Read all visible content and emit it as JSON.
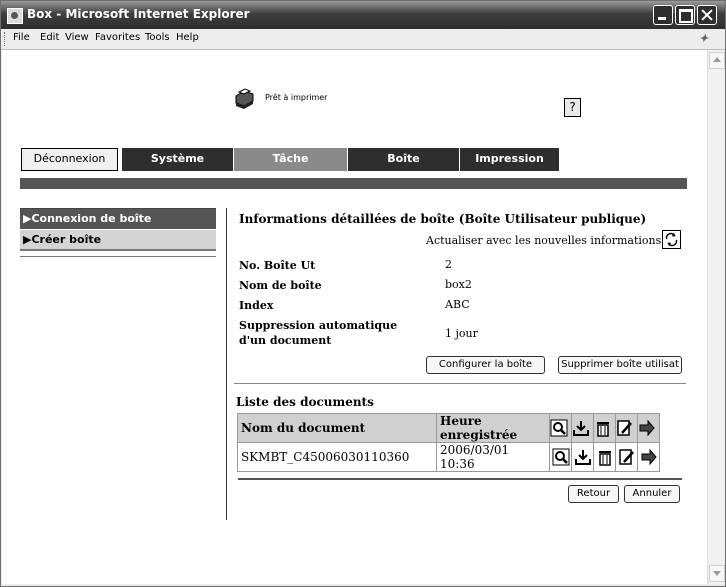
{
  "window": {
    "title": "Box - Microsoft Internet Explorer"
  },
  "menu": [
    "File",
    "Edit",
    "View",
    "Favorites",
    "Tools",
    "Help"
  ],
  "header": {
    "status": "Prêt à imprimer",
    "help": "?"
  },
  "tabs": {
    "logout": "Déconnexion",
    "system": "Système",
    "task": "Tâche",
    "box": "Boîte",
    "print": "Impression"
  },
  "sidebar": {
    "items": [
      {
        "label": "▶Connexion de boîte"
      },
      {
        "label": "▶Créer boîte"
      }
    ]
  },
  "details": {
    "title": "Informations détaillées de boîte (Boîte Utilisateur publique)",
    "refresh_label": "Actualiser avec les nouvelles informations",
    "fields": [
      {
        "label": "No. Boîte Ut",
        "value": "2"
      },
      {
        "label": "Nom de boîte",
        "value": "box2"
      },
      {
        "label": "Index",
        "value": "ABC"
      },
      {
        "label": "Suppression automatique d'un document",
        "value": "1 jour"
      }
    ],
    "configure_button": "Configurer la boîte",
    "delete_button": "Supprimer boîte utilisat"
  },
  "documents": {
    "title": "Liste des documents",
    "columns": [
      "Nom du document",
      "Heure enregistrée"
    ],
    "rows": [
      {
        "name": "SKMBT_C45006030110360",
        "time": "2006/03/01  10:36"
      }
    ]
  },
  "footer": {
    "back_button": "Retour",
    "cancel_button": "Annuler"
  }
}
